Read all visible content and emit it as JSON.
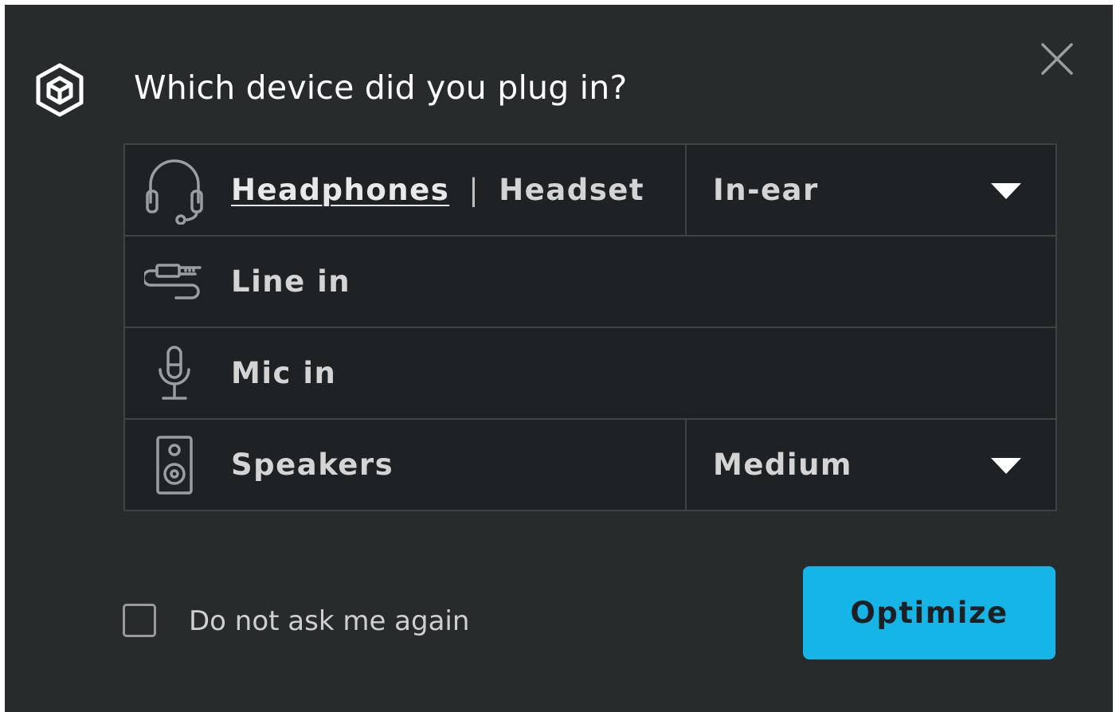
{
  "dialog": {
    "title": "Which device did you plug in?",
    "logo_icon": "cube-logo-icon",
    "close_icon": "close-icon"
  },
  "devices": [
    {
      "icon": "headset-icon",
      "options": [
        "Headphones",
        "Headset"
      ],
      "selected_option": "Headphones",
      "dropdown": {
        "value": "In-ear",
        "icon": "caret-down-icon"
      }
    },
    {
      "icon": "line-in-cable-icon",
      "label": "Line in"
    },
    {
      "icon": "microphone-icon",
      "label": "Mic in"
    },
    {
      "icon": "speaker-icon",
      "label": "Speakers",
      "dropdown": {
        "value": "Medium",
        "icon": "caret-down-icon"
      }
    }
  ],
  "footer": {
    "checkbox_label": "Do not ask me again",
    "checkbox_checked": false,
    "button_label": "Optimize"
  },
  "colors": {
    "background": "#272b2c",
    "row_background": "#1f2225",
    "border": "#3f4344",
    "accent": "#16b5e8"
  }
}
